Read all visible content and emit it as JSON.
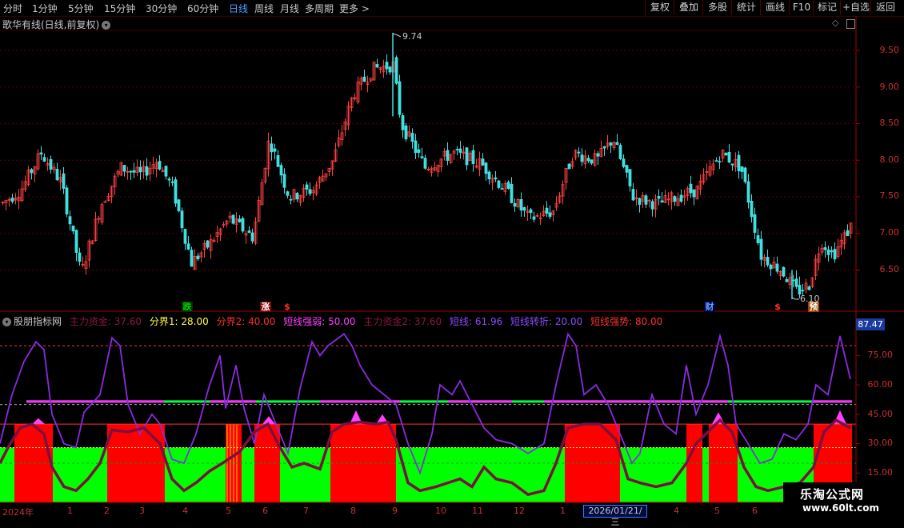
{
  "toolbar": {
    "periods": [
      "分时",
      "1分钟",
      "5分钟",
      "15分钟",
      "30分钟",
      "60分钟",
      "日线",
      "周线",
      "月线",
      "多周期",
      "更多 >"
    ],
    "active_period": "日线",
    "buttons": [
      "复权",
      "叠加",
      "多股",
      "统计",
      "画线",
      "F10",
      "标记",
      "+自选",
      "返回"
    ]
  },
  "main_pane": {
    "title": "歌华有线(日线,前复权)",
    "y_ticks": [
      "9.50",
      "9.00",
      "8.50",
      "8.00",
      "7.50",
      "7.00",
      "6.50"
    ],
    "high_label": "9.74",
    "low_label": "6.10",
    "signals": [
      {
        "text": "跌",
        "color": "#00c000",
        "bg": "#004000"
      },
      {
        "text": "涨",
        "color": "#ffffff",
        "bg": "#800000"
      },
      {
        "text": "$",
        "color": "#ff3030",
        "bg": "#000000"
      },
      {
        "text": "财",
        "color": "#60a0ff",
        "bg": "#000040"
      },
      {
        "text": "$",
        "color": "#ff3030",
        "bg": "#000000"
      },
      {
        "text": "预",
        "color": "#ffffff",
        "bg": "#a04000"
      }
    ]
  },
  "indicator_pane": {
    "name": "股朋指标网",
    "legend": [
      {
        "text": "主力资金: 37.60",
        "color": "#8a1a3a"
      },
      {
        "text": "分界1: 28.00",
        "color": "#ffff40"
      },
      {
        "text": "分界2: 40.00",
        "color": "#ff3030"
      },
      {
        "text": "短线强弱: 50.00",
        "color": "#ff40ff"
      },
      {
        "text": "主力资金2: 37.60",
        "color": "#8a1a3a"
      },
      {
        "text": "短线: 61.96",
        "color": "#8a4cff"
      },
      {
        "text": "短线转折: 20.00",
        "color": "#8a4cff"
      },
      {
        "text": "短线强势: 80.00",
        "color": "#ff3030"
      }
    ],
    "current_value": "87.47",
    "y_ticks": [
      "75.00",
      "60.00",
      "45.00",
      "30.00",
      "15.00"
    ]
  },
  "x_axis": {
    "labels": [
      "2024年",
      "1",
      "2",
      "3",
      "4",
      "5",
      "6",
      "7",
      "8",
      "9",
      "10",
      "11",
      "12",
      "1",
      "4",
      "5",
      "6"
    ],
    "cursor_date": "2026/01/21/三"
  },
  "watermark": {
    "line1": "乐淘公式网",
    "line2": "www.60lt.com"
  },
  "colors": {
    "up": "#ff4040",
    "down": "#40e0e0",
    "zone_red": "#ff0000",
    "zone_green": "#00ff00",
    "line_purple": "#8a2be2",
    "line_maroon": "#7a1040"
  }
}
